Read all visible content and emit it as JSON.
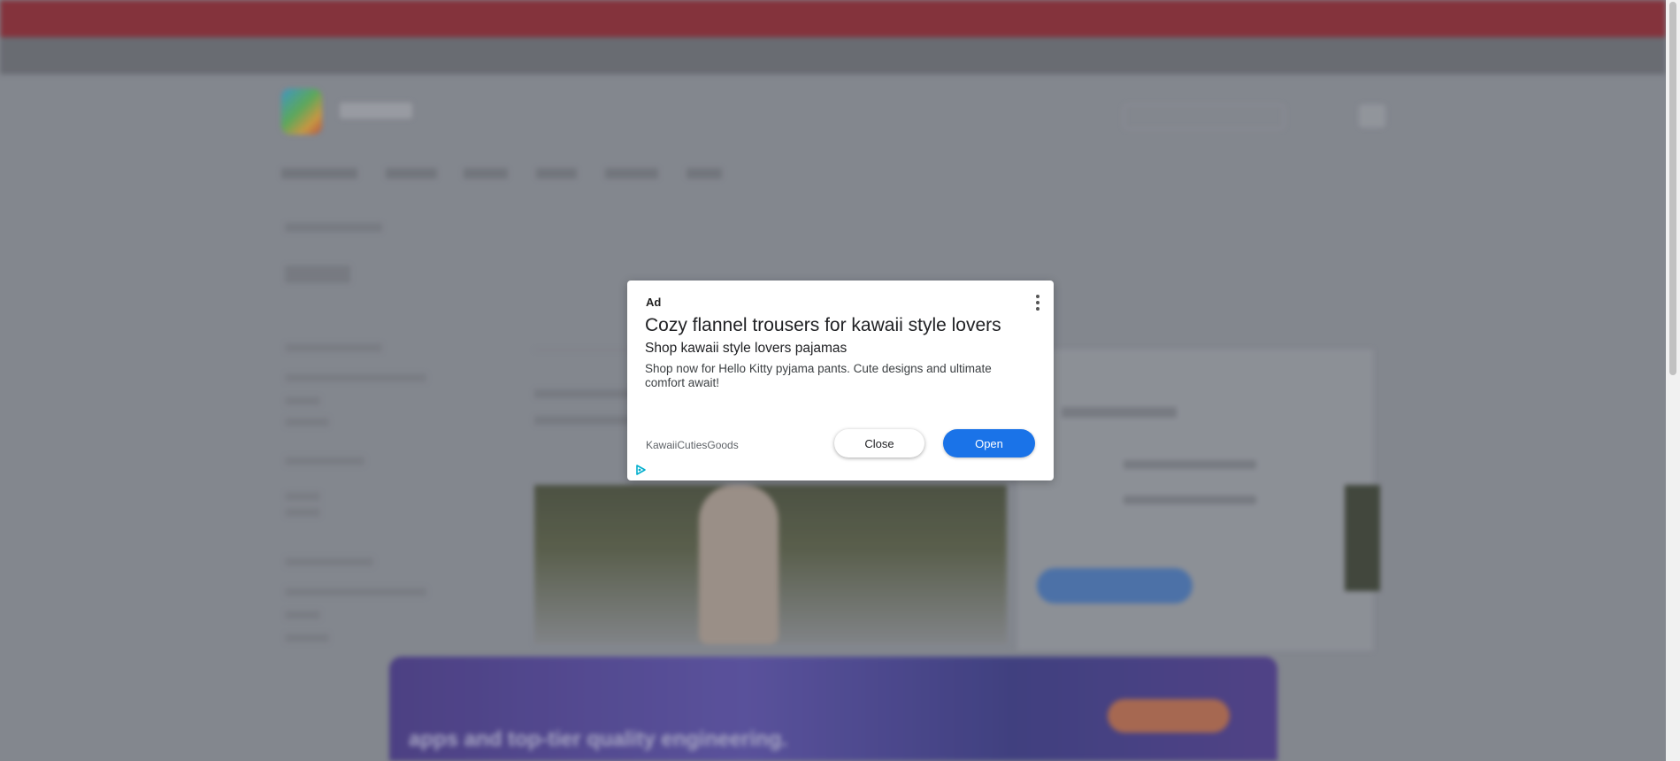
{
  "ad": {
    "label": "Ad",
    "title": "Cozy flannel trousers for kawaii style lovers",
    "subtitle": "Shop kawaii style lovers pajamas",
    "description": "Shop now for Hello Kitty pyjama pants. Cute designs and ultimate comfort await!",
    "advertiser": "KawaiiCutiesGoods",
    "close_label": "Close",
    "open_label": "Open",
    "menu_icon": "more-vert-icon",
    "adchoices_icon": "adchoices-icon"
  },
  "background": {
    "promo_text": "apps and top-tier quality engineering.",
    "colors": {
      "banner": "#8e2a34",
      "promo": "#4a3a8a",
      "open_button": "#1a73e8"
    }
  }
}
